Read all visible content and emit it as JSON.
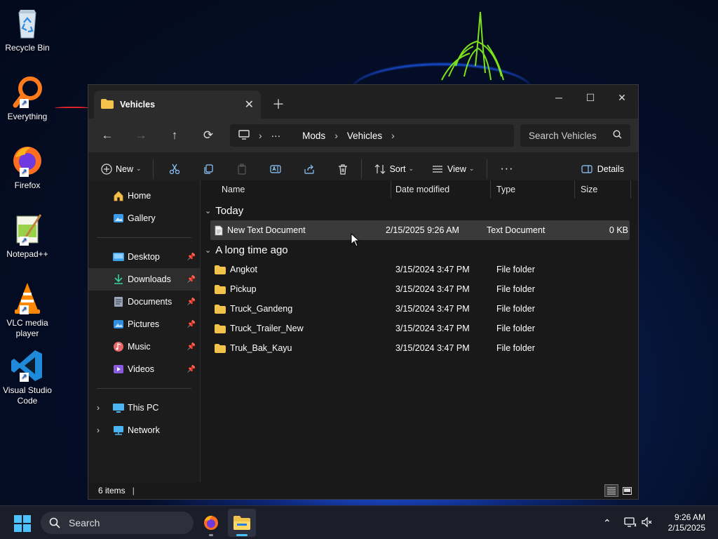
{
  "desktop": {
    "icons": [
      {
        "label": "Recycle Bin",
        "icon": "recycle-bin-icon"
      },
      {
        "label": "Everything",
        "icon": "everything-search-icon"
      },
      {
        "label": "Firefox",
        "icon": "firefox-icon"
      },
      {
        "label": "Notepad++",
        "icon": "notepadpp-icon"
      },
      {
        "label": "VLC media player",
        "icon": "vlc-icon"
      },
      {
        "label": "Visual Studio Code",
        "icon": "vscode-icon"
      }
    ]
  },
  "window": {
    "tab_title": "Vehicles",
    "controls": {
      "minimize": "─",
      "maximize": "☐",
      "close": "✕"
    },
    "address": {
      "root_icon": "this-pc-icon",
      "ellipsis": "···",
      "crumbs": [
        "Mods",
        "Vehicles"
      ]
    },
    "search_placeholder": "Search Vehicles",
    "toolbar": {
      "new_label": "New",
      "sort_label": "Sort",
      "view_label": "View",
      "more_label": "···",
      "details_label": "Details"
    },
    "sidebar": {
      "top": [
        {
          "label": "Home",
          "icon": "home-icon"
        },
        {
          "label": "Gallery",
          "icon": "gallery-icon"
        }
      ],
      "pinned": [
        {
          "label": "Desktop",
          "icon": "desktop-folder-icon"
        },
        {
          "label": "Downloads",
          "icon": "downloads-icon"
        },
        {
          "label": "Documents",
          "icon": "documents-icon"
        },
        {
          "label": "Pictures",
          "icon": "pictures-icon"
        },
        {
          "label": "Music",
          "icon": "music-icon"
        },
        {
          "label": "Videos",
          "icon": "videos-icon"
        }
      ],
      "tree": [
        {
          "label": "This PC",
          "icon": "this-pc-icon"
        },
        {
          "label": "Network",
          "icon": "network-icon"
        }
      ],
      "selected": "Downloads"
    },
    "columns": {
      "name": "Name",
      "date": "Date modified",
      "type": "Type",
      "size": "Size"
    },
    "groups": [
      {
        "label": "Today",
        "items": [
          {
            "name": "New Text Document",
            "date": "2/15/2025 9:26 AM",
            "type": "Text Document",
            "size": "0 KB",
            "kind": "file",
            "selected": true
          }
        ]
      },
      {
        "label": "A long time ago",
        "items": [
          {
            "name": "Angkot",
            "date": "3/15/2024 3:47 PM",
            "type": "File folder",
            "size": "",
            "kind": "folder"
          },
          {
            "name": "Pickup",
            "date": "3/15/2024 3:47 PM",
            "type": "File folder",
            "size": "",
            "kind": "folder"
          },
          {
            "name": "Truck_Gandeng",
            "date": "3/15/2024 3:47 PM",
            "type": "File folder",
            "size": "",
            "kind": "folder"
          },
          {
            "name": "Truck_Trailer_New",
            "date": "3/15/2024 3:47 PM",
            "type": "File folder",
            "size": "",
            "kind": "folder"
          },
          {
            "name": "Truk_Bak_Kayu",
            "date": "3/15/2024 3:47 PM",
            "type": "File folder",
            "size": "",
            "kind": "folder"
          }
        ]
      }
    ],
    "status": {
      "item_count": "6 items"
    }
  },
  "taskbar": {
    "search_label": "Search",
    "apps": [
      "firefox-icon",
      "file-explorer-icon"
    ],
    "time": "9:26 AM",
    "date": "2/15/2025"
  },
  "colors": {
    "folder": "#f3c24b",
    "accent": "#4cc2ff"
  }
}
